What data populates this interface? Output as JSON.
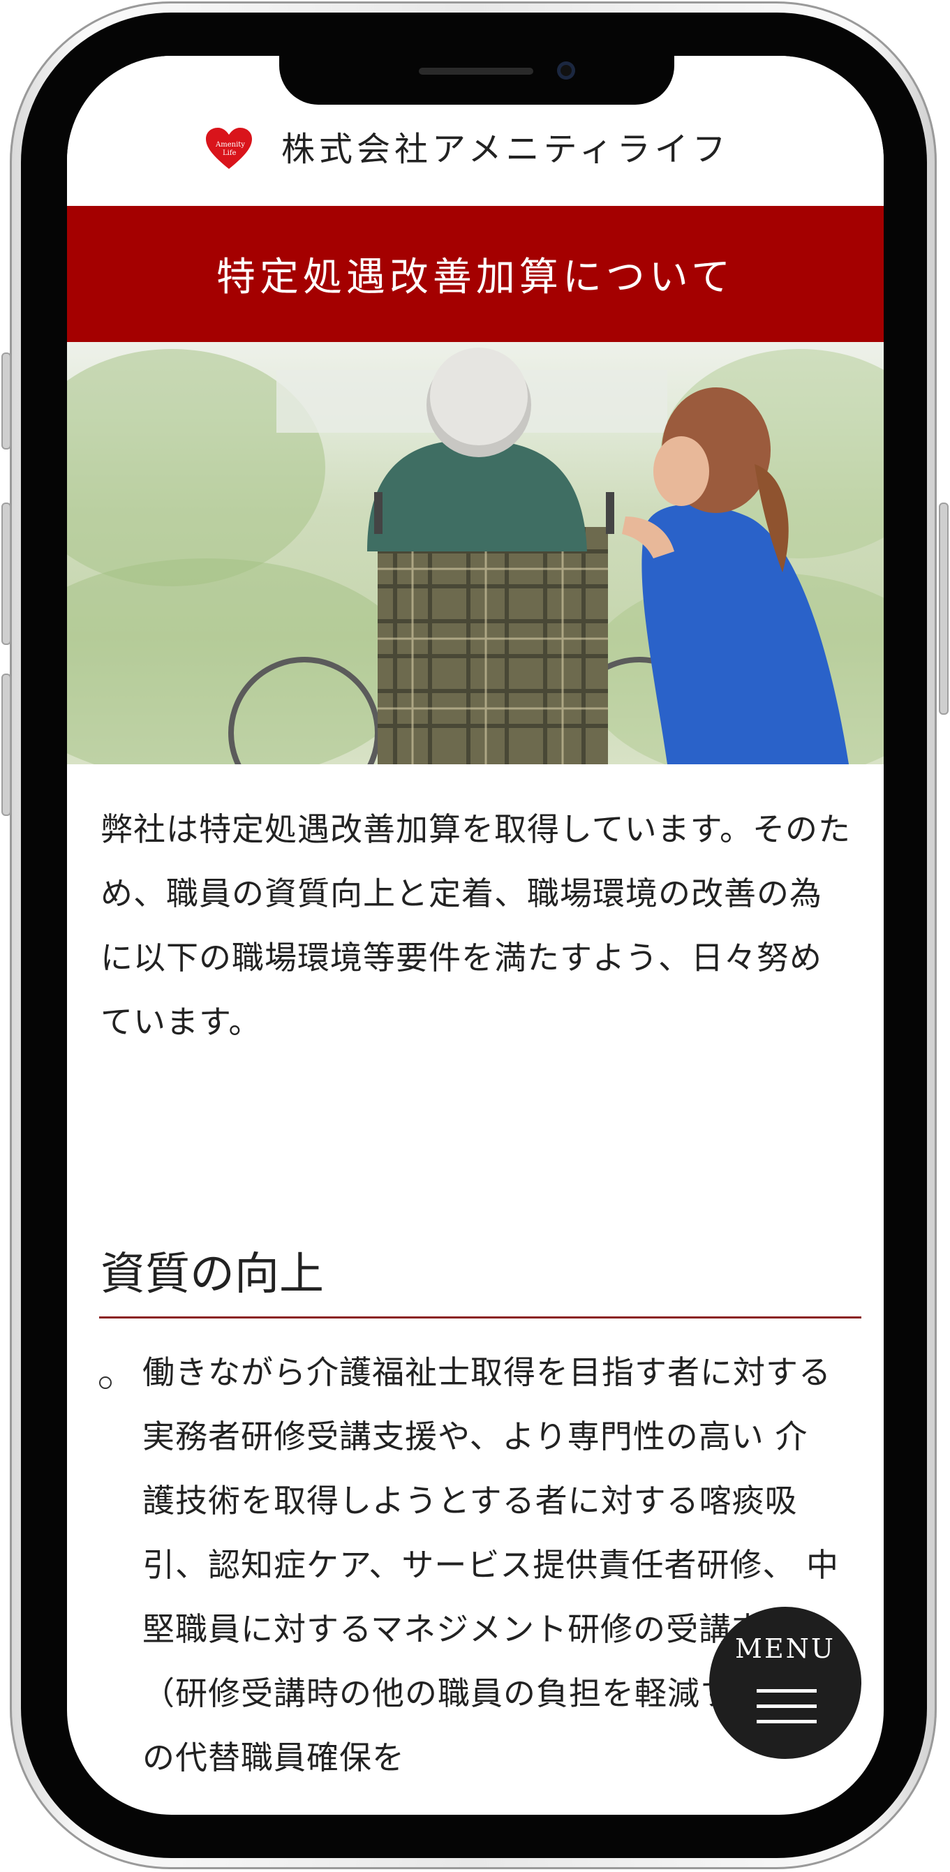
{
  "header": {
    "logo_text": "Amenity Life",
    "company_name": "株式会社アメニティライフ"
  },
  "page": {
    "title": "特定処遇改善加算について"
  },
  "hero": {
    "icon": "elderly-wheelchair-caregiver-photo"
  },
  "intro": {
    "text": "弊社は特定処遇改善加算を取得しています。そのため、職員の資質向上と定着、職場環境の改善の為に以下の職場環境等要件を満たすよう、日々努めています。"
  },
  "section": {
    "title": "資質の向上",
    "items": [
      "働きながら介護福祉士取得を目指す者に対する実務者研修受講支援や、より専門性の高い 介護技術を取得しようとする者に対する喀痰吸引、認知症ケア、サービス提供責任者研修、 中堅職員に対するマネジメント研修の受講支援（研修受講時の他の職員の負担を軽減するための代替職員確保を"
    ]
  },
  "menu": {
    "label": "MENU"
  },
  "colors": {
    "brand_red": "#a40000",
    "rule": "#8a1c1c",
    "menu_bg": "#1e1e1e"
  }
}
